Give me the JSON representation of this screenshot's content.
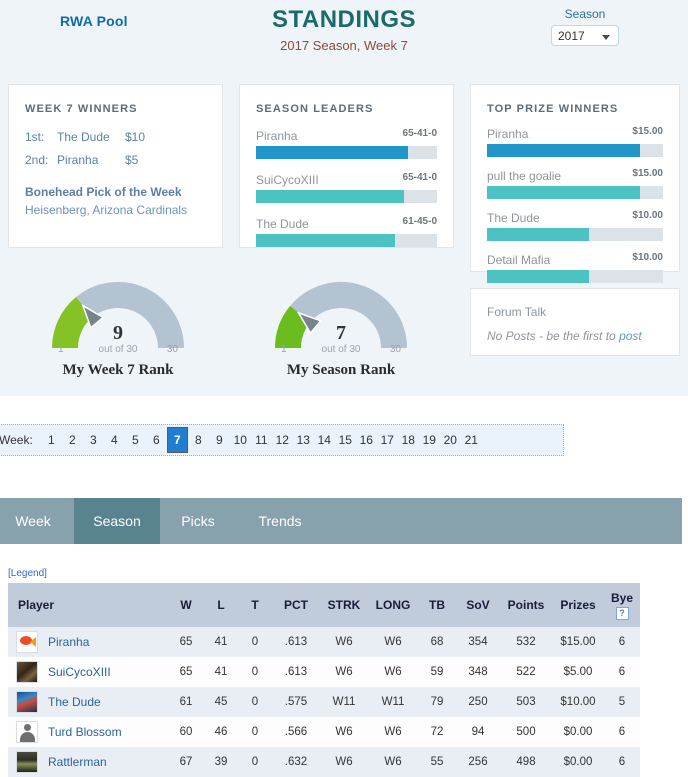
{
  "header": {
    "pool_name": "RWA Pool",
    "title": "STANDINGS",
    "subtitle": "2017 Season, Week 7",
    "season_label": "Season",
    "season_value": "2017"
  },
  "week_winners": {
    "title": "WEEK 7 WINNERS",
    "rows": [
      {
        "place": "1st:",
        "name": "The Dude",
        "amount": "$10"
      },
      {
        "place": "2nd:",
        "name": "Piranha",
        "amount": "$5"
      }
    ],
    "bonehead_title": "Bonehead Pick of the Week",
    "bonehead_value": "Heisenberg, Arizona Cardinals"
  },
  "season_leaders": {
    "title": "SEASON LEADERS",
    "rows": [
      {
        "name": "Piranha",
        "value": "65-41-0",
        "pct": 84,
        "color": "#2196c8"
      },
      {
        "name": "SuiCycoXIII",
        "value": "65-41-0",
        "pct": 82,
        "color": "#4cc2c2"
      },
      {
        "name": "The Dude",
        "value": "61-45-0",
        "pct": 77,
        "color": "#4cc2c2"
      }
    ]
  },
  "top_prize_winners": {
    "title": "TOP PRIZE WINNERS",
    "rows": [
      {
        "name": "Piranha",
        "value": "$15.00",
        "pct": 87,
        "color": "#2196c8"
      },
      {
        "name": "pull the goalie",
        "value": "$15.00",
        "pct": 87,
        "color": "#4cc2c2"
      },
      {
        "name": "The Dude",
        "value": "$10.00",
        "pct": 58,
        "color": "#4cc2c2"
      },
      {
        "name": "Detail Mafia",
        "value": "$10.00",
        "pct": 58,
        "color": "#4cc2c2"
      }
    ]
  },
  "forum": {
    "title": "Forum Talk",
    "text": "No Posts - be the first to ",
    "link": "post"
  },
  "gauges": [
    {
      "id": "week",
      "value": "9",
      "out_of": "out of 30",
      "min": "1",
      "max": "30",
      "caption": "My Week 7 Rank",
      "fill_fraction": 0.28,
      "fill_color": "#84c225",
      "track_color": "#b3c3d1"
    },
    {
      "id": "season",
      "value": "7",
      "out_of": "out of 30",
      "min": "1",
      "max": "30",
      "caption": "My Season Rank",
      "fill_fraction": 0.22,
      "fill_color": "#6bbd1e",
      "track_color": "#b3c3d1"
    }
  ],
  "week_selector": {
    "label": "Week:",
    "weeks": [
      "1",
      "2",
      "3",
      "4",
      "5",
      "6",
      "7",
      "8",
      "9",
      "10",
      "11",
      "12",
      "13",
      "14",
      "15",
      "16",
      "17",
      "18",
      "19",
      "20",
      "21"
    ],
    "selected": "7"
  },
  "tabs": [
    {
      "label": "Week",
      "active": false
    },
    {
      "label": "Season",
      "active": true
    },
    {
      "label": "Picks",
      "active": false
    },
    {
      "label": "Trends",
      "active": false
    }
  ],
  "legend_link": "[Legend]",
  "table": {
    "columns": [
      "Player",
      "W",
      "L",
      "T",
      "PCT",
      "STRK",
      "LONG",
      "TB",
      "SoV",
      "Points",
      "Prizes",
      "Bye"
    ],
    "bye_icon": "broken-image-question-icon",
    "rows": [
      {
        "player": "Piranha",
        "avatar": "av-fish",
        "W": "65",
        "L": "41",
        "T": "0",
        "PCT": ".613",
        "STRK": "W6",
        "LONG": "W6",
        "TB": "68",
        "SoV": "354",
        "Points": "532",
        "Prizes": "$15.00",
        "Bye": "6"
      },
      {
        "player": "SuiCycoXIII",
        "avatar": "av-dark",
        "W": "65",
        "L": "41",
        "T": "0",
        "PCT": ".613",
        "STRK": "W6",
        "LONG": "W6",
        "TB": "59",
        "SoV": "348",
        "Points": "522",
        "Prizes": "$5.00",
        "Bye": "6"
      },
      {
        "player": "The Dude",
        "avatar": "av-blue",
        "W": "61",
        "L": "45",
        "T": "0",
        "PCT": ".575",
        "STRK": "W11",
        "LONG": "W11",
        "TB": "79",
        "SoV": "250",
        "Points": "503",
        "Prizes": "$10.00",
        "Bye": "5"
      },
      {
        "player": "Turd Blossom",
        "avatar": "av-person",
        "W": "60",
        "L": "46",
        "T": "0",
        "PCT": ".566",
        "STRK": "W6",
        "LONG": "W6",
        "TB": "72",
        "SoV": "94",
        "Points": "500",
        "Prizes": "$0.00",
        "Bye": "6"
      },
      {
        "player": "Rattlerman",
        "avatar": "av-nature",
        "W": "67",
        "L": "39",
        "T": "0",
        "PCT": ".632",
        "STRK": "W6",
        "LONG": "W6",
        "TB": "55",
        "SoV": "256",
        "Points": "498",
        "Prizes": "$0.00",
        "Bye": "6"
      }
    ]
  }
}
